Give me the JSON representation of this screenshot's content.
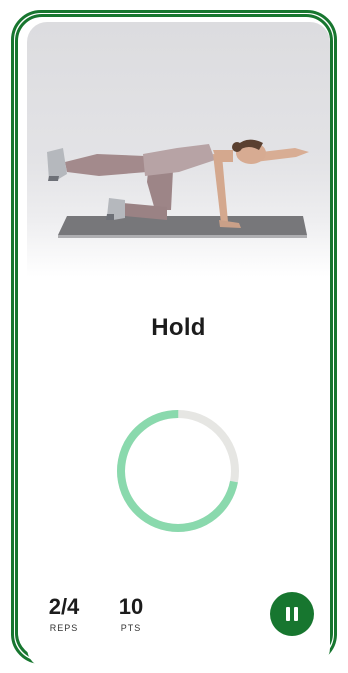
{
  "exercise": {
    "phase_label": "Hold",
    "image_icon": "bird-dog-exercise-photo"
  },
  "timer": {
    "progress": 0.72,
    "track_color": "#e6e6e3",
    "progress_color": "#8ad9ad"
  },
  "stats": {
    "reps_value": "2/4",
    "reps_label": "REPS",
    "points_value": "10",
    "points_label": "PTS"
  },
  "controls": {
    "pause_icon": "pause-icon",
    "accent_color": "#17762f"
  }
}
